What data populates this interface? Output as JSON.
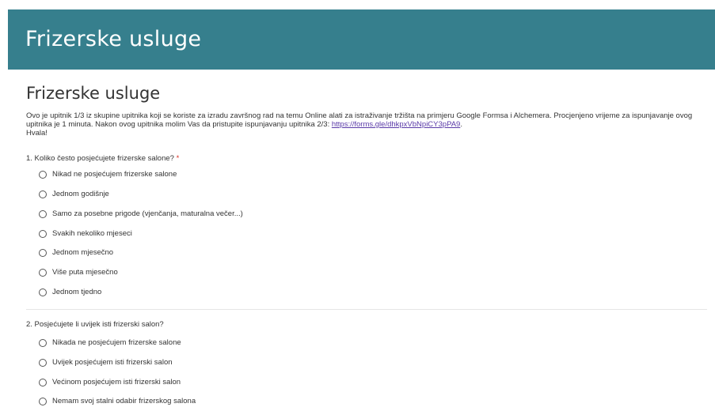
{
  "header": {
    "title": "Frizerske usluge"
  },
  "form": {
    "title": "Frizerske usluge",
    "description_text": "Ovo je upitnik 1/3 iz skupine upitnika koji se koriste za izradu završnog rad na temu Online alati za istraživanje tržišta na primjeru Google Formsa i Alchemera. Procjenjeno vrijeme za ispunjavanje ovog upitnika je 1 minuta. Nakon ovog upitnika molim Vas da pristupite ispunjavanju upitnika 2/3: ",
    "description_link": "https://forms.gle/dhkpxVbNpiCY3pPA9",
    "description_after_link": ".",
    "description_signoff": "Hvala!"
  },
  "questions": [
    {
      "label": "1. Koliko često posjećujete frizerske salone?",
      "required_mark": "*",
      "options": [
        "Nikad ne posjećujem frizerske salone",
        "Jednom godišnje",
        "Samo za posebne prigode (vjenčanja, maturalna večer...)",
        "Svakih nekoliko mjeseci",
        "Jednom mjesečno",
        "Više puta mjesečno",
        "Jednom tjedno"
      ]
    },
    {
      "label": "2. Posjećujete li uvijek isti frizerski salon?",
      "options": [
        "Nikada ne posjećujem frizerske salone",
        "Uvijek posjećujem isti frizerski salon",
        "Većinom posjećujem isti frizerski salon",
        "Nemam svoj stalni odabir frizerskog salona"
      ]
    }
  ],
  "colors": {
    "header_background": "#367f8d",
    "header_text": "#ffffff",
    "link": "#5a3aa8",
    "required": "#d93025"
  },
  "icons": {
    "radio": "radio-unchecked-icon"
  }
}
